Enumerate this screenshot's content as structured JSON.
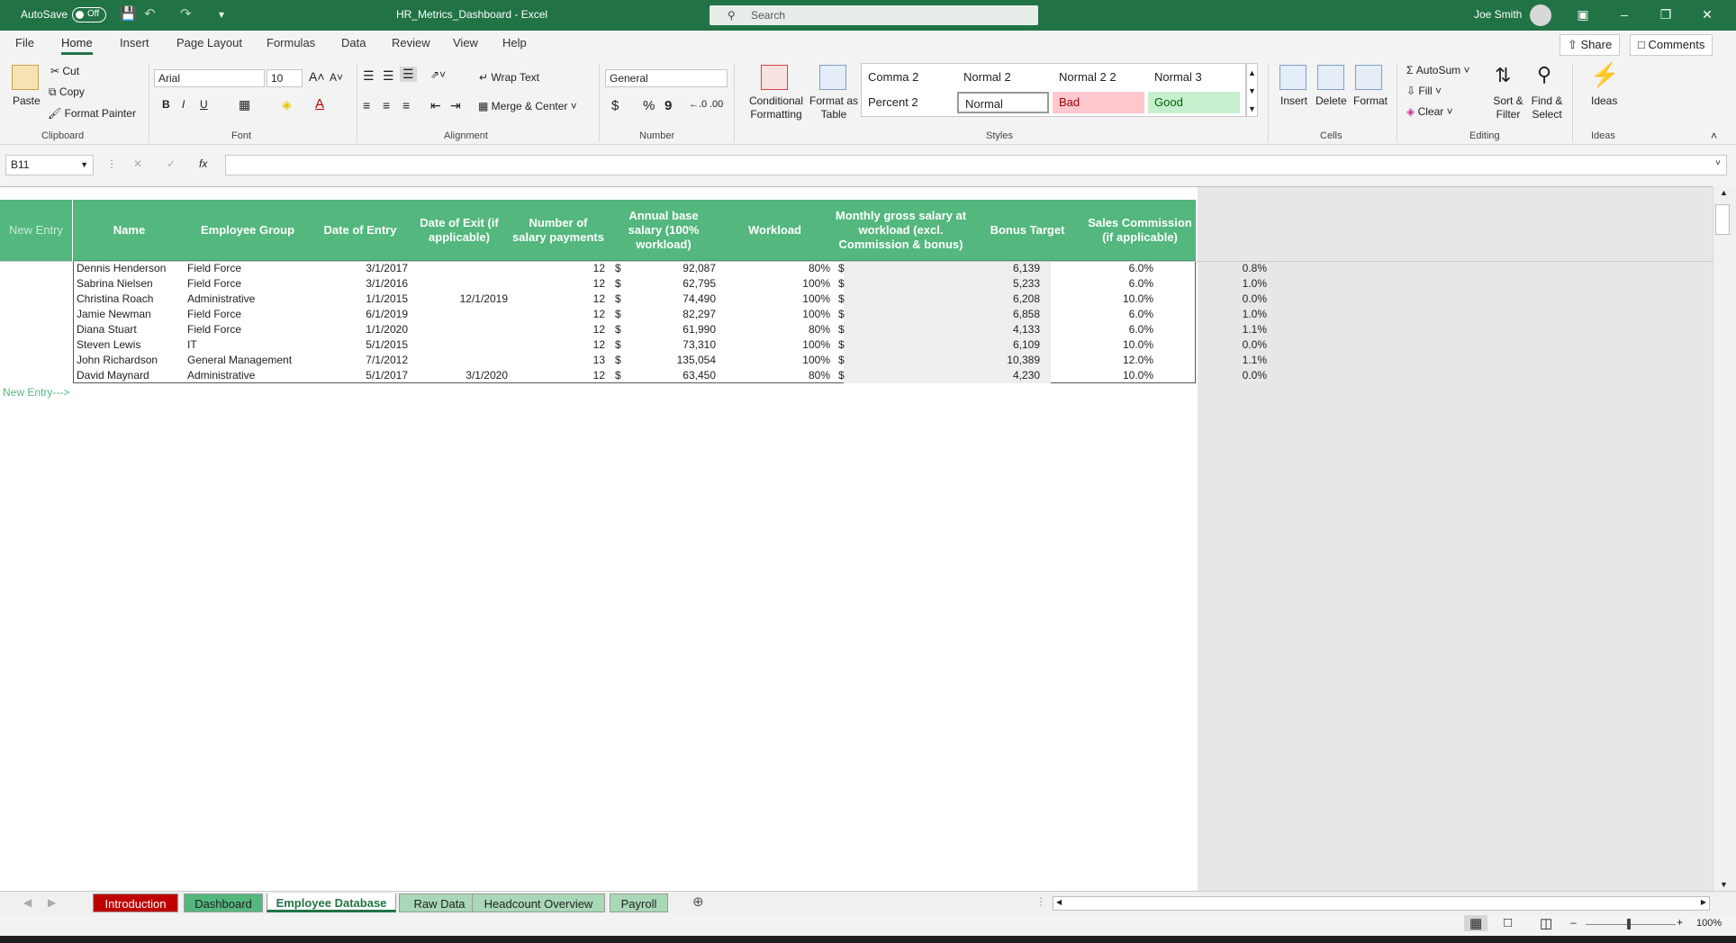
{
  "titlebar": {
    "autosave_label": "AutoSave",
    "autosave_state": "Off",
    "doc_title": "HR_Metrics_Dashboard  -  Excel",
    "search_placeholder": "Search",
    "user_name": "Joe Smith"
  },
  "menu": {
    "tabs": [
      "File",
      "Home",
      "Insert",
      "Page Layout",
      "Formulas",
      "Data",
      "Review",
      "View",
      "Help"
    ],
    "active": "Home",
    "share": "Share",
    "comments": "Comments"
  },
  "ribbon": {
    "clipboard": {
      "paste": "Paste",
      "cut": "Cut",
      "copy": "Copy",
      "format_painter": "Format Painter",
      "group": "Clipboard"
    },
    "font": {
      "name": "Arial",
      "size": "10",
      "group": "Font",
      "bold": "B",
      "italic": "I",
      "underline": "U"
    },
    "alignment": {
      "wrap": "Wrap Text",
      "merge": "Merge & Center",
      "group": "Alignment"
    },
    "number": {
      "format": "General",
      "group": "Number",
      "currency": "$",
      "percent": "%",
      "comma": "9"
    },
    "styles": {
      "conditional": "Conditional Formatting",
      "format_table": "Format as Table",
      "cells": [
        "Comma 2",
        "Normal 2",
        "Normal 2 2",
        "Normal 3",
        "Percent 2",
        "Normal",
        "Bad",
        "Good"
      ],
      "group": "Styles"
    },
    "cells": {
      "insert": "Insert",
      "delete": "Delete",
      "format": "Format",
      "group": "Cells"
    },
    "editing": {
      "autosum": "AutoSum",
      "fill": "Fill",
      "clear": "Clear",
      "sort": "Sort & Filter",
      "find": "Find & Select",
      "group": "Editing"
    },
    "ideas": {
      "label": "Ideas",
      "group": "Ideas"
    }
  },
  "formula_bar": {
    "name_box": "B11",
    "fx": "fx",
    "value": ""
  },
  "table": {
    "new_entry_header": "New Entry",
    "headers": [
      "Name",
      "Employee Group",
      "Date of Entry",
      "Date of Exit (if applicable)",
      "Number of salary payments",
      "Annual base salary (100% workload)",
      "Workload",
      "Monthly gross salary at workload (excl. Commission & bonus)",
      "Bonus Target",
      "Sales Commission (if applicable)"
    ],
    "rows": [
      {
        "name": "Dennis Henderson",
        "group": "Field Force",
        "entry": "3/1/2017",
        "exit": "",
        "payments": "12",
        "cur1": "$",
        "annual": "92,087",
        "workload": "80%",
        "cur2": "$",
        "monthly": "6,139",
        "bonus": "6.0%",
        "commission": "0.8%"
      },
      {
        "name": "Sabrina Nielsen",
        "group": "Field Force",
        "entry": "3/1/2016",
        "exit": "",
        "payments": "12",
        "cur1": "$",
        "annual": "62,795",
        "workload": "100%",
        "cur2": "$",
        "monthly": "5,233",
        "bonus": "6.0%",
        "commission": "1.0%"
      },
      {
        "name": "Christina Roach",
        "group": "Administrative",
        "entry": "1/1/2015",
        "exit": "12/1/2019",
        "payments": "12",
        "cur1": "$",
        "annual": "74,490",
        "workload": "100%",
        "cur2": "$",
        "monthly": "6,208",
        "bonus": "10.0%",
        "commission": "0.0%"
      },
      {
        "name": "Jamie Newman",
        "group": "Field Force",
        "entry": "6/1/2019",
        "exit": "",
        "payments": "12",
        "cur1": "$",
        "annual": "82,297",
        "workload": "100%",
        "cur2": "$",
        "monthly": "6,858",
        "bonus": "6.0%",
        "commission": "1.0%"
      },
      {
        "name": "Diana Stuart",
        "group": "Field Force",
        "entry": "1/1/2020",
        "exit": "",
        "payments": "12",
        "cur1": "$",
        "annual": "61,990",
        "workload": "80%",
        "cur2": "$",
        "monthly": "4,133",
        "bonus": "6.0%",
        "commission": "1.1%"
      },
      {
        "name": "Steven Lewis",
        "group": "IT",
        "entry": "5/1/2015",
        "exit": "",
        "payments": "12",
        "cur1": "$",
        "annual": "73,310",
        "workload": "100%",
        "cur2": "$",
        "monthly": "6,109",
        "bonus": "10.0%",
        "commission": "0.0%"
      },
      {
        "name": "John Richardson",
        "group": "General Management",
        "entry": "7/1/2012",
        "exit": "",
        "payments": "13",
        "cur1": "$",
        "annual": "135,054",
        "workload": "100%",
        "cur2": "$",
        "monthly": "10,389",
        "bonus": "12.0%",
        "commission": "1.1%"
      },
      {
        "name": "David Maynard",
        "group": "Administrative",
        "entry": "5/1/2017",
        "exit": "3/1/2020",
        "payments": "12",
        "cur1": "$",
        "annual": "63,450",
        "workload": "80%",
        "cur2": "$",
        "monthly": "4,230",
        "bonus": "10.0%",
        "commission": "0.0%"
      }
    ],
    "new_entry_marker": "New Entry--->"
  },
  "sheet_tabs": [
    {
      "label": "Introduction",
      "bg": "#c00000",
      "fg": "#ffffff"
    },
    {
      "label": "Dashboard",
      "bg": "#53b77e",
      "fg": "#222222"
    },
    {
      "label": "Employee Database",
      "bg": "#ffffff",
      "fg": "#217346",
      "active": true
    },
    {
      "label": "Raw Data",
      "bg": "#a9d8b8",
      "fg": "#222222"
    },
    {
      "label": "Headcount Overview",
      "bg": "#a9d8b8",
      "fg": "#222222"
    },
    {
      "label": "Payroll",
      "bg": "#a9d8b8",
      "fg": "#222222"
    }
  ],
  "status": {
    "zoom": "100%"
  },
  "colors": {
    "brand": "#217346",
    "header_green": "#53b77e",
    "bad_bg": "#ffc7ce",
    "bad_fg": "#9c0006",
    "good_bg": "#c6efce",
    "good_fg": "#006100"
  }
}
